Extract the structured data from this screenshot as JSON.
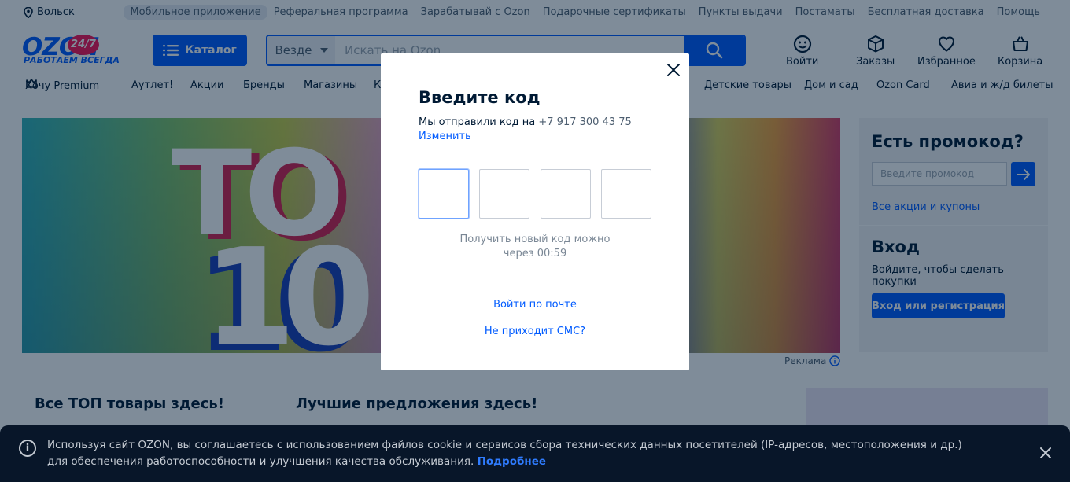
{
  "topbar": {
    "city": "Вольск",
    "links": [
      "Мобильное приложение",
      "Реферальная программа",
      "Зарабатывай с Ozon",
      "Подарочные сертификаты",
      "Пункты выдачи",
      "Постаматы",
      "Бесплатная доставка",
      "Помощь"
    ]
  },
  "logo": {
    "text": "OZON",
    "badge": "24/7",
    "tagline": "РАБОТАЕМ ВСЕГДА"
  },
  "header": {
    "catalog_label": "Каталог",
    "search_scope": "Везде",
    "search_placeholder": "Искать на Ozon",
    "login_label": "Войти",
    "orders_label": "Заказы",
    "favorites_label": "Избранное",
    "cart_label": "Корзина"
  },
  "nav": [
    "Хочу Premium",
    "Аутлет!",
    "Акции",
    "Бренды",
    "Магазины",
    "К",
    "Детские товары",
    "Дом и сад",
    "Ozon Card",
    "Авиа и ж/д билеты"
  ],
  "banner": {
    "line1": "TO",
    "line2": "10",
    "ad_label": "Реклама"
  },
  "side": {
    "promo_title": "Есть промокод?",
    "promo_placeholder": "Введите промокод",
    "promo_link": "Все акции и купоны",
    "login_title": "Вход",
    "login_text": "Войдите, чтобы сделать покупки",
    "login_button": "Вход или регистрация"
  },
  "sections": {
    "top": "Все ТОП товары здесь!",
    "best": "Лучшие предложения здесь!"
  },
  "cookie": {
    "text": "Используя сайт OZON, вы соглашаетесь с использованием файлов cookie и сервисов сбора технических данных посетителей (IP-адресов, местоположения и др.) для обеспечения работоспособности и улучшения качества обслуживания.",
    "more": "Подробнее"
  },
  "modal": {
    "title": "Введите код",
    "sent_prefix": "Мы отправили код на",
    "phone": "+7 917 300 43 75",
    "change": "Изменить",
    "resend_line1": "Получить новый код можно",
    "resend_line2": "через 00:59",
    "email_login": "Войти по почте",
    "no_sms": "Не приходит СМС?"
  },
  "colors": {
    "brand": "#005bff",
    "accent": "#f91155",
    "text": "#001a34"
  }
}
